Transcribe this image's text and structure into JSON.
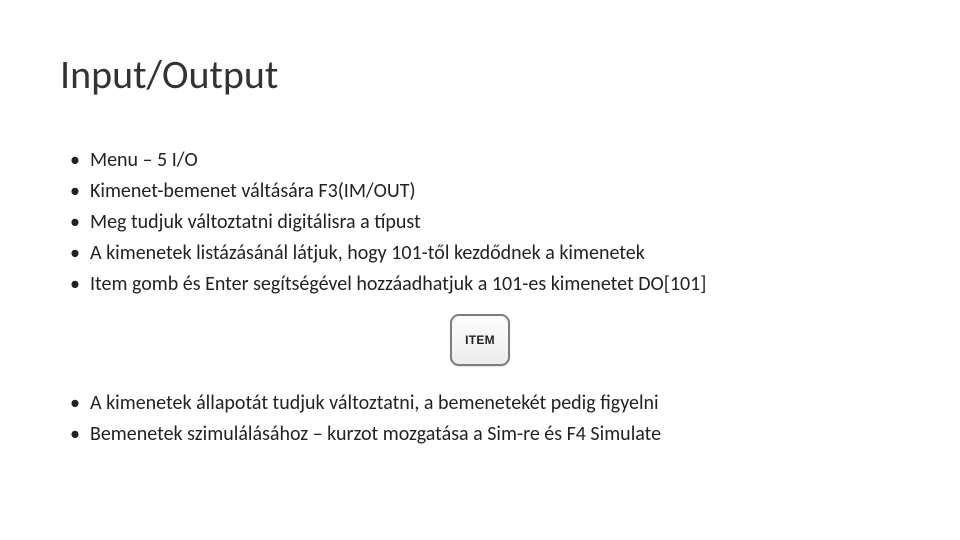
{
  "title": "Input/Output",
  "bullets_top": [
    "Menu – 5 I/O",
    "Kimenet-bemenet váltására F3(IM/OUT)",
    "Meg tudjuk változtatni digitálisra a típust",
    "A kimenetek listázásánál látjuk, hogy 101-től kezdődnek a kimenetek",
    "Item gomb és Enter segítségével hozzáadhatjuk a 101-es kimenetet DO[101]"
  ],
  "item_button_label": "ITEM",
  "bullets_bottom": [
    "A kimenetek állapotát tudjuk változtatni, a bemenetekét pedig figyelni",
    "Bemenetek szimulálásához – kurzot mozgatása a Sim-re és F4 Simulate"
  ]
}
